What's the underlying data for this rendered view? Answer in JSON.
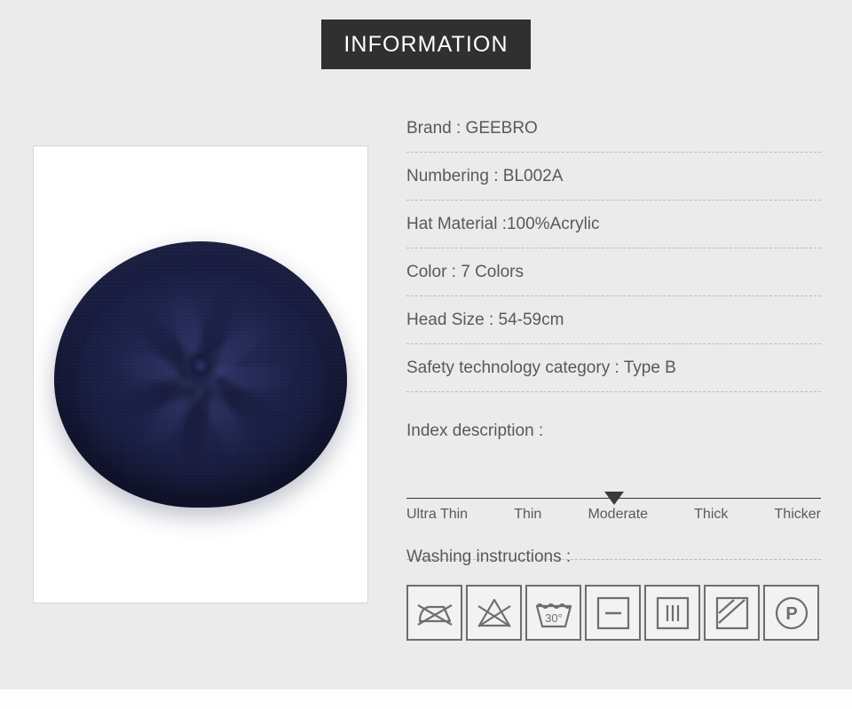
{
  "header": {
    "title": "INFORMATION"
  },
  "product_image": {
    "alt": "navy knitted beret hat",
    "color_hex": "#1e2250",
    "background_hex": "#ffffff"
  },
  "page": {
    "background_hex": "#ebebeb",
    "text_color_hex": "#595959",
    "banner_background_hex": "#303030"
  },
  "specs": [
    {
      "label": "Brand",
      "value": "GEEBRO",
      "text": "Brand : GEEBRO"
    },
    {
      "label": "Numbering",
      "value": "BL002A",
      "text": "Numbering : BL002A"
    },
    {
      "label": "Hat Material",
      "value": "100%Acrylic",
      "text": "Hat Material :100%Acrylic"
    },
    {
      "label": "Color",
      "value": "7 Colors",
      "text": "Color : 7 Colors"
    },
    {
      "label": "Head Size",
      "value": "54-59cm",
      "text": "Head Size : 54-59cm"
    },
    {
      "label": "Safety technology category",
      "value": "Type B",
      "text": "Safety technology category : Type B"
    }
  ],
  "index_description": {
    "title": "Index description :",
    "levels": [
      "Ultra Thin",
      "Thin",
      "Moderate",
      "Thick",
      "Thicker"
    ],
    "selected": "Moderate",
    "selected_index": 2,
    "marker_position_percent": 50
  },
  "washing": {
    "title": "Washing instructions :",
    "symbols": [
      {
        "name": "do-not-iron-icon",
        "label": "Do not iron"
      },
      {
        "name": "do-not-bleach-icon",
        "label": "Do not bleach"
      },
      {
        "name": "wash-30-degrees-icon",
        "label": "Wash at 30 degrees",
        "temperature": "30°"
      },
      {
        "name": "dry-flat-icon",
        "label": "Dry flat"
      },
      {
        "name": "drip-dry-icon",
        "label": "Drip dry"
      },
      {
        "name": "dry-in-shade-icon",
        "label": "Dry in shade"
      },
      {
        "name": "professional-dry-clean-icon",
        "label": "Professional dry clean",
        "letter": "P"
      }
    ]
  }
}
